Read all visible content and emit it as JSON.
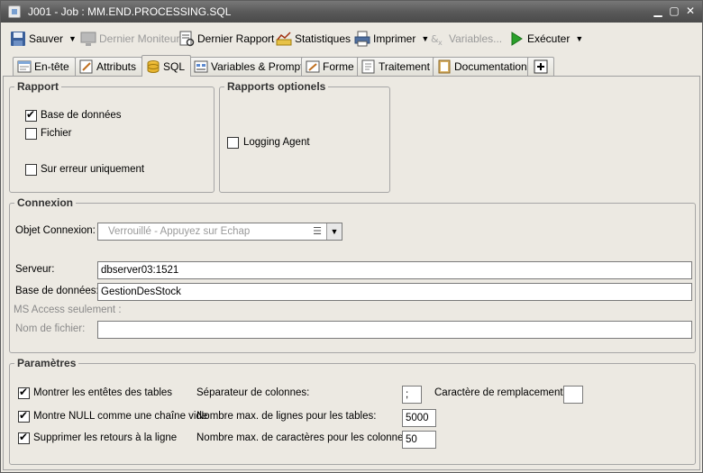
{
  "window": {
    "title": "J001 - Job : MM.END.PROCESSING.SQL",
    "min_icon": "minimize-icon",
    "max_icon": "maximize-icon",
    "close_icon": "close-icon"
  },
  "toolbar": {
    "save": "Sauver",
    "last_monitor": "Dernier Moniteur",
    "last_report": "Dernier Rapport",
    "stats": "Statistiques",
    "print": "Imprimer",
    "variables": "Variables...",
    "execute": "Exécuter"
  },
  "tabs": [
    {
      "label": "En-tête",
      "icon": "header-icon"
    },
    {
      "label": "Attributs",
      "icon": "attributes-icon"
    },
    {
      "label": "SQL",
      "icon": "database-icon"
    },
    {
      "label": "Variables & Prompts",
      "icon": "variables-icon"
    },
    {
      "label": "Forme",
      "icon": "form-icon"
    },
    {
      "label": "Traitement",
      "icon": "processing-icon"
    },
    {
      "label": "Documentation",
      "icon": "documentation-icon"
    },
    {
      "label": "",
      "icon": "add-tab-icon"
    }
  ],
  "rapport": {
    "title": "Rapport",
    "database": {
      "label": "Base de données",
      "checked": true
    },
    "file": {
      "label": "Fichier",
      "checked": false
    },
    "on_error": {
      "label": "Sur erreur uniquement",
      "checked": false
    }
  },
  "rapports_optionels": {
    "title": "Rapports optionels",
    "logging_agent": {
      "label": "Logging Agent",
      "checked": false
    }
  },
  "connexion": {
    "title": "Connexion",
    "object_label": "Objet Connexion:",
    "object_placeholder": "Verrouillé - Appuyez sur Echap",
    "server_label": "Serveur:",
    "server_value": "dbserver03:1521",
    "db_label": "Base de données:",
    "db_value": "GestionDesStock",
    "ms_access": "MS Access seulement :",
    "filename_label": "Nom de fichier:",
    "filename_value": ""
  },
  "parametres": {
    "title": "Paramètres",
    "show_headers": {
      "label": "Montrer les entêtes des tables",
      "checked": true
    },
    "null_empty": {
      "label": "Montre NULL comme une chaîne vide",
      "checked": true
    },
    "remove_returns": {
      "label": "Supprimer les retours à la ligne",
      "checked": true
    },
    "col_sep_label": "Séparateur de colonnes:",
    "col_sep_value": ";",
    "replace_char_label": "Caractère de remplacement:",
    "replace_char_value": "",
    "max_rows_label": "Nombre max. de lignes pour les tables:",
    "max_rows_value": "5000",
    "max_chars_label": "Nombre max. de caractères pour les colonnes:",
    "max_chars_value": "50"
  }
}
